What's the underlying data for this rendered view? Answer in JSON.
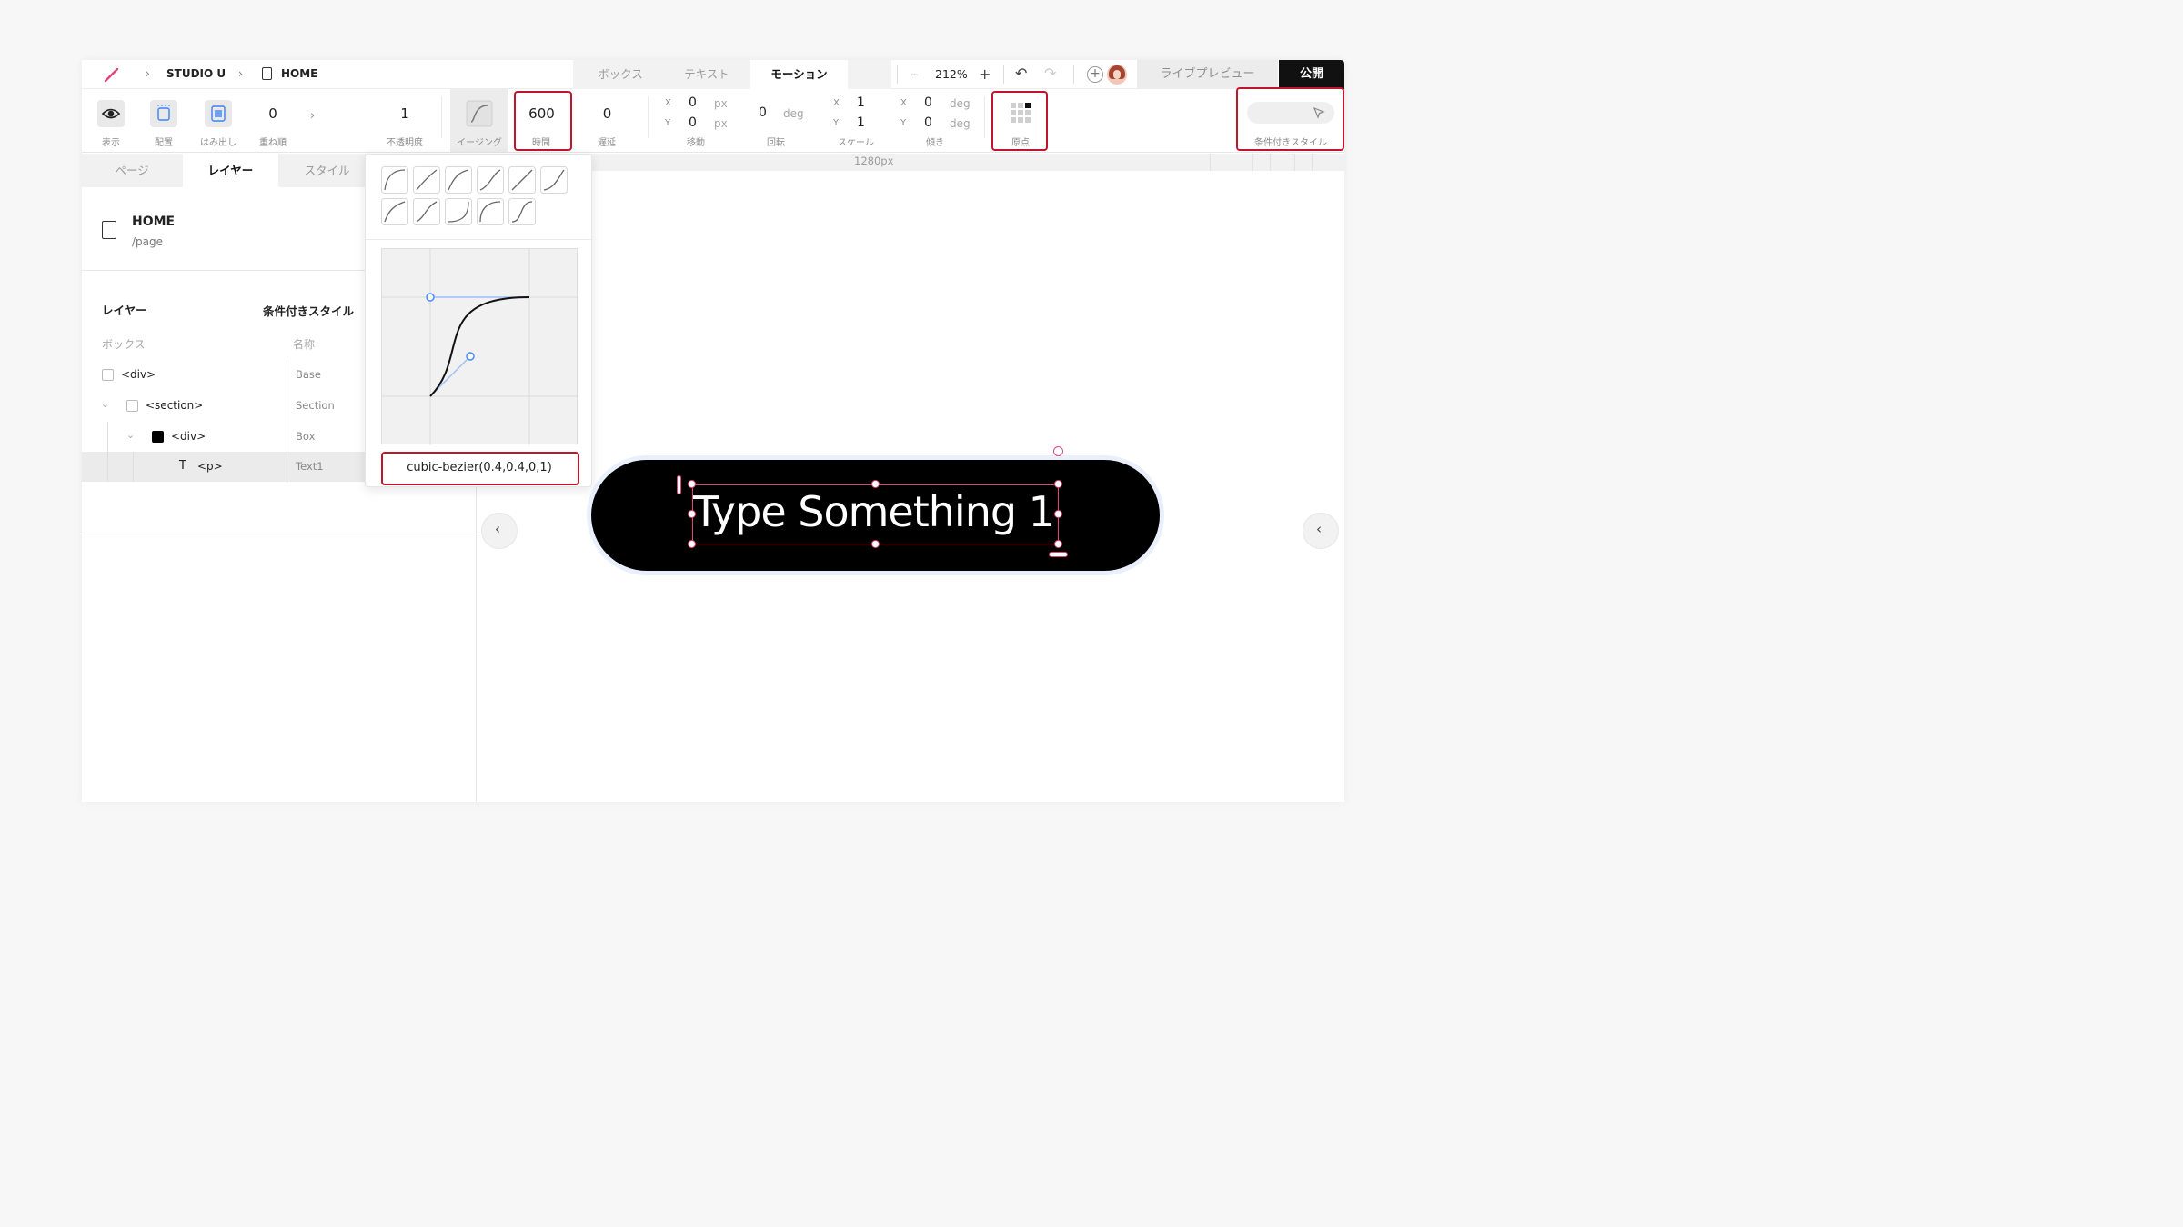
{
  "colors": {
    "accent": "#e0457b",
    "highlight": "#c0162c",
    "publish_bg": "#111111",
    "curve_handle": "#4a8cf5"
  },
  "header": {
    "breadcrumb": {
      "project": "STUDIO U",
      "page": "HOME"
    },
    "mode_tabs": [
      "ボックス",
      "テキスト",
      "モーション"
    ],
    "active_mode": "モーション",
    "zoom": "212%",
    "live_preview": "ライブプレビュー",
    "publish": "公開"
  },
  "toolbar": {
    "display_label": "表示",
    "placement_label": "配置",
    "overflow_label": "はみ出し",
    "stack_value": "0",
    "stack_label": "重ね順",
    "opacity_value": "1",
    "opacity_label": "不透明度",
    "easing_label": "イージング",
    "duration_value": "600",
    "duration_label": "時間",
    "delay_value": "0",
    "delay_label": "遅延",
    "move": {
      "x": "0",
      "y": "0",
      "unit": "px",
      "label": "移動"
    },
    "rotate": {
      "value": "0",
      "unit": "deg",
      "label": "回転"
    },
    "scale": {
      "x": "1",
      "y": "1",
      "label": "スケール"
    },
    "skew": {
      "x": "0",
      "y": "0",
      "unit": "deg",
      "label": "傾き"
    },
    "origin_label": "原点",
    "conditional_label": "条件付きスタイル",
    "axis_x": "X",
    "axis_y": "Y"
  },
  "left_panel": {
    "tabs": [
      "ページ",
      "レイヤー",
      "スタイル"
    ],
    "active_tab": "レイヤー",
    "page": {
      "name": "HOME",
      "path": "/page"
    },
    "layers_title": "レイヤー",
    "conditional_title": "条件付きスタイル",
    "col_box": "ボックス",
    "col_name": "名称",
    "rows": [
      {
        "tag": "<div>",
        "name": "Base"
      },
      {
        "tag": "<section>",
        "name": "Section"
      },
      {
        "tag": "<div>",
        "name": "Box"
      },
      {
        "tag": "<p>",
        "name": "Text1"
      }
    ]
  },
  "canvas": {
    "width_label": "1280px",
    "element_text": "Type Something 1"
  },
  "easing_popup": {
    "bezier": "cubic-bezier(0.4,0.4,0,1)",
    "preset_count": 11
  }
}
